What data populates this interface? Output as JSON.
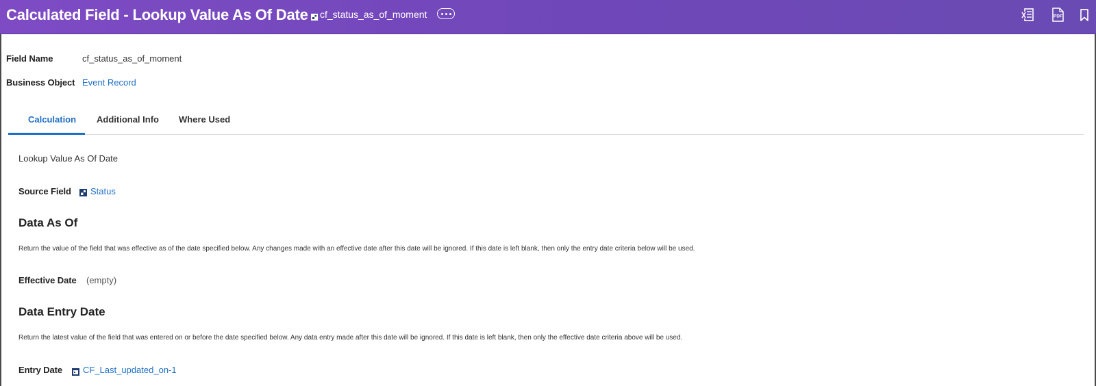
{
  "header": {
    "title": "Calculated Field - Lookup Value As Of Date",
    "field_id": "cf_status_as_of_moment",
    "more_icon": "ellipsis-icon",
    "actions": [
      "excel-export-icon",
      "pdf-export-icon",
      "bookmark-icon"
    ]
  },
  "fields": {
    "field_name_label": "Field Name",
    "field_name_value": "cf_status_as_of_moment",
    "business_object_label": "Business Object",
    "business_object_value": "Event Record"
  },
  "tabs": [
    {
      "label": "Calculation",
      "active": true
    },
    {
      "label": "Additional Info",
      "active": false
    },
    {
      "label": "Where Used",
      "active": false
    }
  ],
  "calculation": {
    "type_text": "Lookup Value As Of Date",
    "source_field_label": "Source Field",
    "source_field_value": "Status",
    "data_as_of": {
      "title": "Data As Of",
      "description": "Return the value of the field that was effective as of the date specified below.  Any changes made with an effective date after this date will be ignored.  If this date is left blank, then only the entry date criteria below will be used.",
      "effective_date_label": "Effective Date",
      "effective_date_value": "(empty)"
    },
    "data_entry_date": {
      "title": "Data Entry Date",
      "description": "Return the latest value of the field that was entered on or before the date specified below.  Any data entry made after this date will be ignored.  If this date is left blank, then only the effective date criteria above will be used.",
      "entry_date_label": "Entry Date",
      "entry_date_value": "CF_Last_updated_on-1"
    }
  },
  "colors": {
    "header_start": "#7e4bc4",
    "header_end": "#6a4bb3",
    "link": "#1f6fc5",
    "icon_navy": "#1e3a6e"
  }
}
